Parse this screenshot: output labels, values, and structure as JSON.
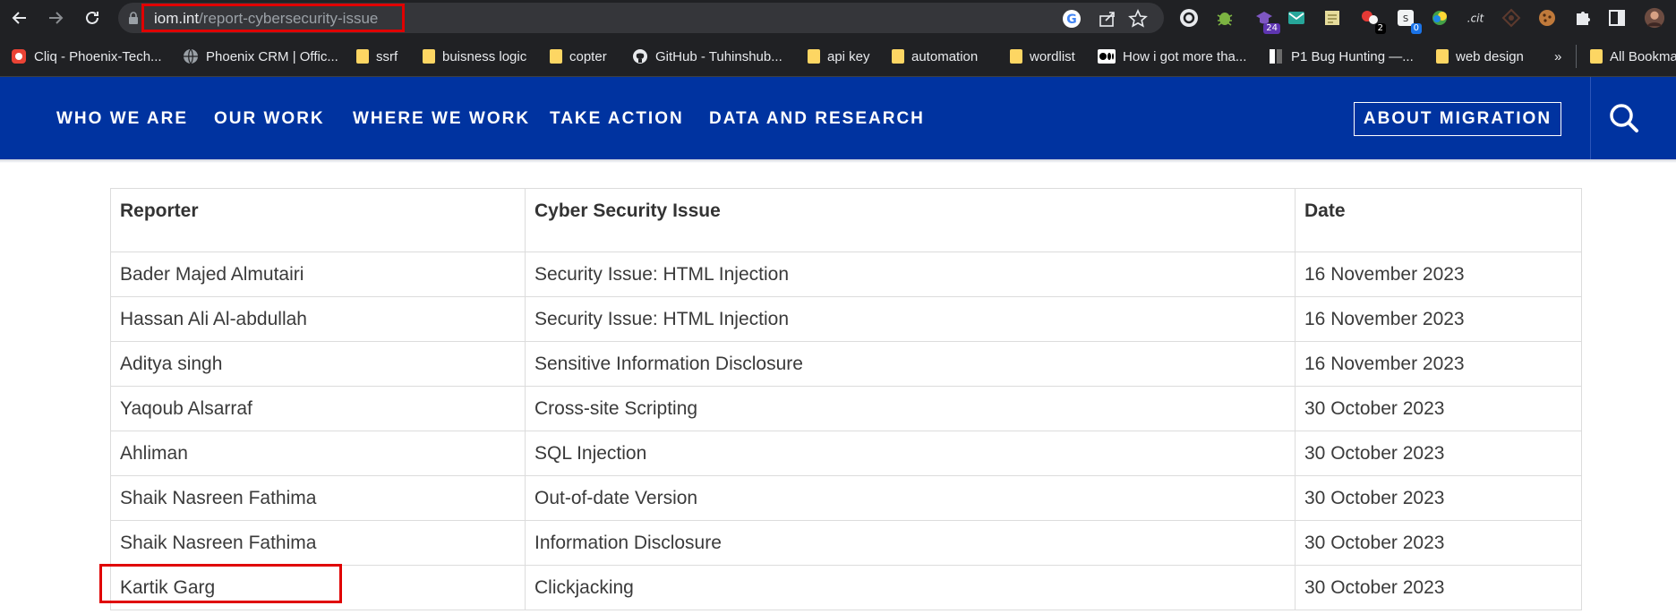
{
  "browser": {
    "url_domain": "iom.int",
    "url_path": "/report-cybersecurity-issue",
    "extensions": [
      {
        "icon": "grammarly-icon"
      },
      {
        "icon": "bug-icon",
        "color": "#7cb342"
      },
      {
        "icon": "hat-icon",
        "badge": "24",
        "badge_color": "#5e35b1"
      },
      {
        "icon": "mail-icon",
        "color": "#26a69a"
      },
      {
        "icon": "note-icon"
      },
      {
        "icon": "shop-icon",
        "badge": "2",
        "badge_color": "#000000"
      },
      {
        "icon": "translate-icon",
        "badge": "0",
        "badge_color": "#1a73e8"
      },
      {
        "icon": "color-icon"
      },
      {
        "icon": "dot-icon"
      },
      {
        "icon": "target-icon"
      },
      {
        "icon": "cookie-icon"
      },
      {
        "icon": "puzzle-icon"
      },
      {
        "icon": "sidepanel-icon"
      },
      {
        "icon": "avatar"
      }
    ],
    "bookmarks": [
      {
        "label": "Cliq - Phoenix-Tech...",
        "icon": "cliq-icon"
      },
      {
        "label": "Phoenix CRM | Offic...",
        "icon": "globe-icon"
      },
      {
        "label": "ssrf",
        "icon": "folder-icon"
      },
      {
        "label": "buisness logic",
        "icon": "folder-icon"
      },
      {
        "label": "copter",
        "icon": "folder-icon"
      },
      {
        "label": "GitHub - Tuhinshub...",
        "icon": "github-icon"
      },
      {
        "label": "api key",
        "icon": "folder-icon"
      },
      {
        "label": "automation",
        "icon": "folder-icon"
      },
      {
        "label": "wordlist",
        "icon": "folder-icon"
      },
      {
        "label": "How i got more tha...",
        "icon": "medium-icon"
      },
      {
        "label": "P1 Bug Hunting —...",
        "icon": "page-icon"
      },
      {
        "label": "web design",
        "icon": "folder-icon"
      }
    ],
    "more_label": "»",
    "all_bookmarks": "All Bookma"
  },
  "nav": {
    "items": [
      "WHO WE ARE",
      "OUR WORK",
      "WHERE WE WORK",
      "TAKE ACTION",
      "DATA AND RESEARCH"
    ],
    "about": "ABOUT MIGRATION",
    "bg_color": "#0033a0"
  },
  "table": {
    "headers": [
      "Reporter",
      "Cyber Security Issue",
      "Date"
    ],
    "rows": [
      {
        "reporter": "Bader Majed Almutairi",
        "issue": "Security Issue: HTML Injection",
        "date": "16 November 2023"
      },
      {
        "reporter": "Hassan Ali Al-abdullah",
        "issue": "Security Issue: HTML Injection",
        "date": "16 November 2023"
      },
      {
        "reporter": "Aditya singh",
        "issue": "Sensitive Information Disclosure",
        "date": "16 November 2023"
      },
      {
        "reporter": "Yaqoub Alsarraf",
        "issue": "Cross-site Scripting",
        "date": "30 October 2023"
      },
      {
        "reporter": "Ahliman",
        "issue": "SQL Injection",
        "date": "30 October 2023"
      },
      {
        "reporter": "Shaik Nasreen Fathima",
        "issue": "Out-of-date Version",
        "date": "30 October 2023"
      },
      {
        "reporter": "Shaik Nasreen Fathima",
        "issue": "Information Disclosure",
        "date": "30 October 2023"
      },
      {
        "reporter": "Kartik Garg",
        "issue": "Clickjacking",
        "date": "30 October 2023"
      }
    ]
  }
}
